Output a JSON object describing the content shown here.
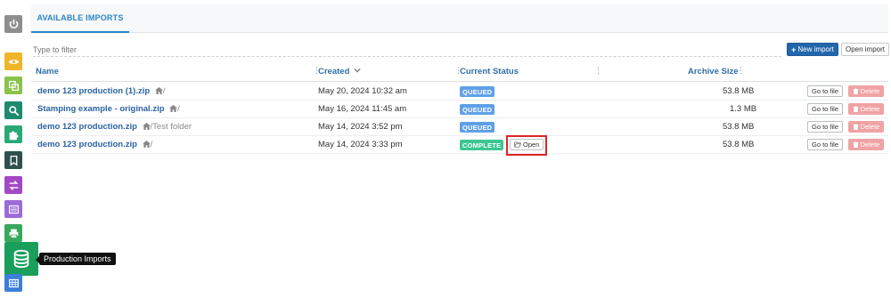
{
  "tab": {
    "label": "AVAILABLE IMPORTS"
  },
  "filter": {
    "placeholder": "Type to filter"
  },
  "toolbar": {
    "new_import_label": "New import",
    "open_import_label": "Open import"
  },
  "columns": {
    "name": "Name",
    "created": "Created",
    "status": "Current Status",
    "size": "Archive Size"
  },
  "rows": [
    {
      "name": "demo 123 production (1).zip",
      "path": "/",
      "created": "May 20, 2024 10:32 am",
      "status": "QUEUED",
      "size": "53.8 MB"
    },
    {
      "name": "Stamping example - original.zip",
      "path": "/",
      "created": "May 16, 2024 11:45 am",
      "status": "QUEUED",
      "size": "1.3 MB"
    },
    {
      "name": "demo 123 production.zip",
      "path": "/Test folder",
      "created": "May 14, 2024 3:52 pm",
      "status": "QUEUED",
      "size": "53.8 MB"
    },
    {
      "name": "demo 123 production.zip",
      "path": "/",
      "created": "May 14, 2024 3:33 pm",
      "status": "COMPLETE",
      "size": "53.8 MB",
      "open_label": "Open"
    }
  ],
  "row_actions": {
    "goto_label": "Go to file",
    "delete_label": "Delete"
  },
  "sidebar": {
    "tooltip": "Production Imports",
    "items": [
      {
        "icon": "power-icon",
        "color": "#8e8e8e"
      },
      {
        "icon": "eye-icon",
        "color": "#f0b429"
      },
      {
        "icon": "copy-icon",
        "color": "#8bc34a"
      },
      {
        "icon": "search-icon",
        "color": "#1e8b6e"
      },
      {
        "icon": "puzzle-icon",
        "color": "#2aa876"
      },
      {
        "icon": "bookmark-icon",
        "color": "#2f4f4f"
      },
      {
        "icon": "transfer-icon",
        "color": "#a347c4"
      },
      {
        "icon": "list-icon",
        "color": "#9b6bd8"
      },
      {
        "icon": "print-icon",
        "color": "#3aa85a"
      },
      {
        "icon": "database-icon",
        "color": "#1a9e5c"
      },
      {
        "icon": "table-icon",
        "color": "#3b7fd9"
      }
    ]
  },
  "colors": {
    "accent": "#2b86c5",
    "primary_button": "#2266aa",
    "highlight": "#d9262a"
  }
}
